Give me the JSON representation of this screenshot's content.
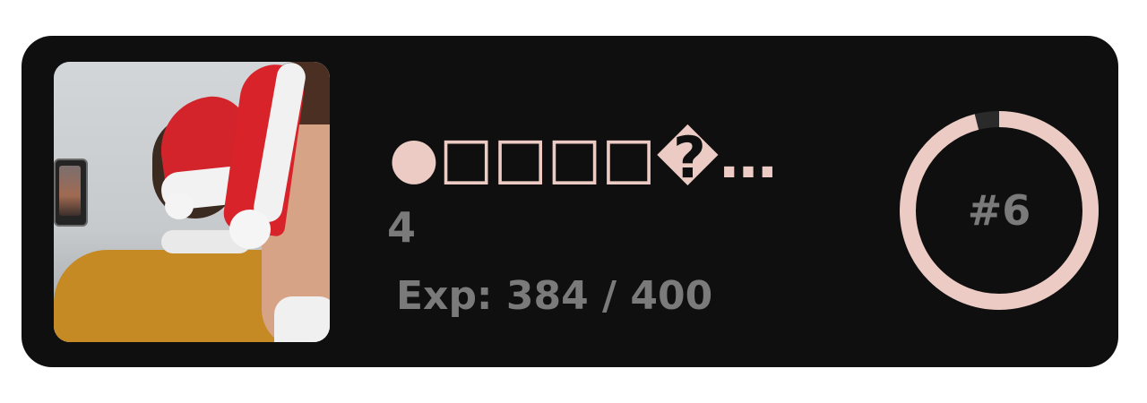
{
  "profile": {
    "name": "●□□□□�…",
    "level": "4",
    "exp_text": "Exp:  384 / 400",
    "rank": "#6",
    "exp_current": 384,
    "exp_max": 400,
    "colors": {
      "card_background": "#0f0f0f",
      "accent": "#ebcbc3",
      "muted_text": "#7a7a7a",
      "ring_track": "#2a2a2a"
    }
  }
}
